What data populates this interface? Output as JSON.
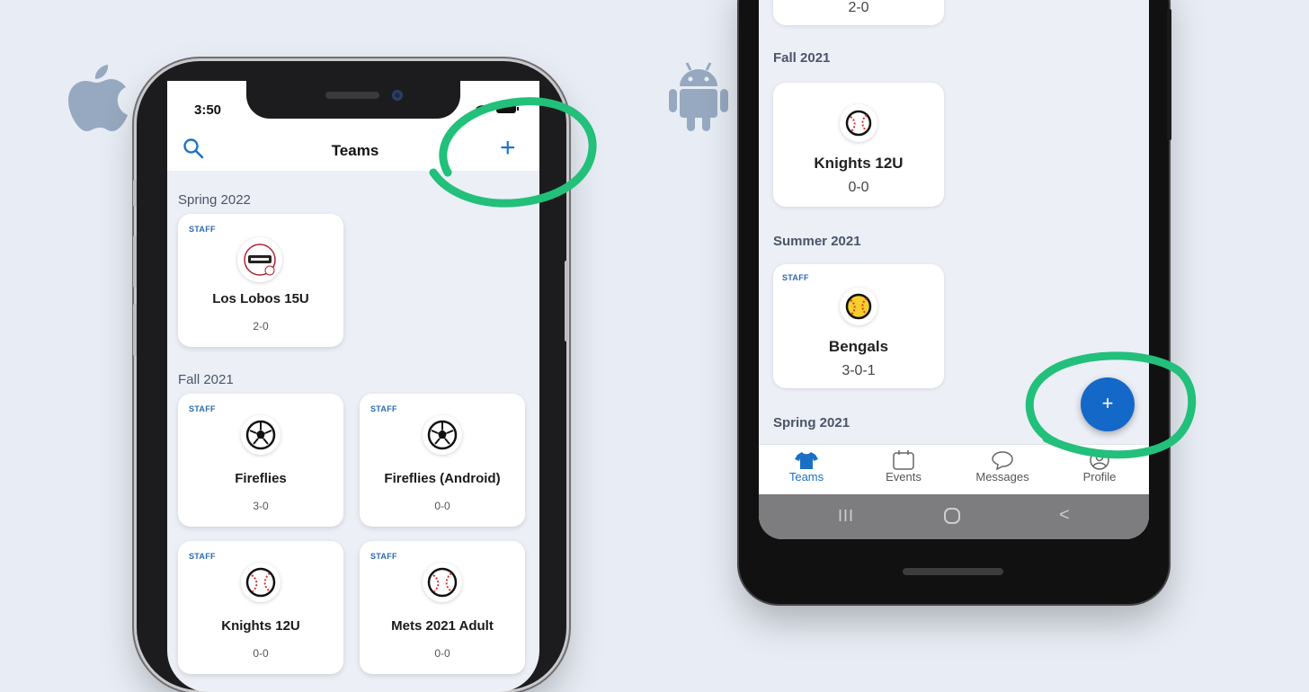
{
  "colors": {
    "accent": "#1a73c9",
    "highlight": "#22c07a",
    "fab": "#1468c8",
    "background": "#e8edf5"
  },
  "ios": {
    "status_time": "3:50",
    "header_title": "Teams",
    "icons": {
      "search": "search-icon",
      "add": "plus-icon"
    },
    "sections": [
      {
        "label": "Spring 2022",
        "teams": [
          {
            "staff": "STAFF",
            "name": "Los Lobos 15U",
            "record": "2-0",
            "icon": "los-lobos-logo-icon"
          }
        ]
      },
      {
        "label": "Fall 2021",
        "teams": [
          {
            "staff": "STAFF",
            "name": "Fireflies",
            "record": "3-0",
            "icon": "soccer-ball-icon"
          },
          {
            "staff": "STAFF",
            "name": "Fireflies (Android)",
            "record": "0-0",
            "icon": "soccer-ball-icon"
          },
          {
            "staff": "STAFF",
            "name": "Knights 12U",
            "record": "0-0",
            "icon": "baseball-icon"
          },
          {
            "staff": "STAFF",
            "name": "Mets 2021 Adult",
            "record": "0-0",
            "icon": "baseball-icon"
          }
        ]
      }
    ]
  },
  "android": {
    "top_partial_record": "2-0",
    "sections": [
      {
        "label": "Fall 2021",
        "teams": [
          {
            "name": "Knights 12U",
            "record": "0-0",
            "icon": "baseball-icon"
          }
        ]
      },
      {
        "label": "Summer 2021",
        "teams": [
          {
            "staff": "STAFF",
            "name": "Bengals",
            "record": "3-0-1",
            "icon": "softball-icon"
          }
        ]
      },
      {
        "label": "Spring 2021",
        "teams": []
      }
    ],
    "fab_label": "+",
    "nav": [
      {
        "label": "Teams",
        "icon": "jersey-icon",
        "active": true
      },
      {
        "label": "Events",
        "icon": "calendar-icon",
        "active": false
      },
      {
        "label": "Messages",
        "icon": "chat-bubble-icon",
        "active": false
      },
      {
        "label": "Profile",
        "icon": "profile-icon",
        "active": false
      }
    ],
    "system_nav": {
      "recents": "III",
      "home": "home-circle-icon",
      "back": "<"
    }
  }
}
